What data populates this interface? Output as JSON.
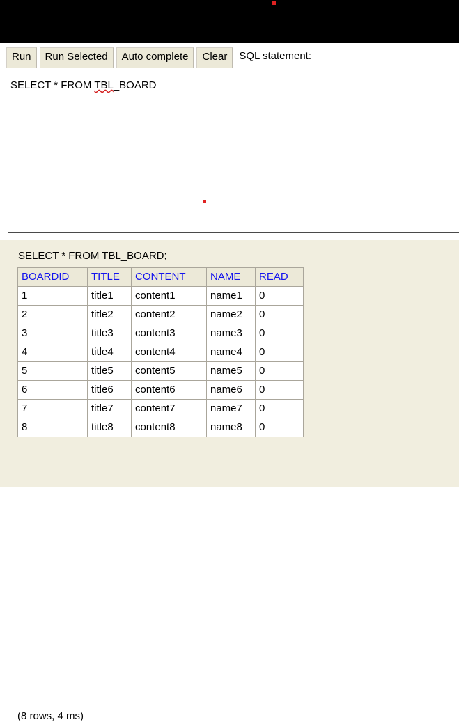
{
  "topbar": {
    "marker_color": "#e02222"
  },
  "toolbar": {
    "buttons": [
      {
        "label": "Run",
        "name": "run-button"
      },
      {
        "label": "Run Selected",
        "name": "run-selected-button"
      },
      {
        "label": "Auto complete",
        "name": "auto-complete-button"
      },
      {
        "label": "Clear",
        "name": "clear-button"
      }
    ],
    "sql_label": "SQL statement:"
  },
  "editor": {
    "value_prefix": "SELECT * FROM ",
    "value_misspelled": "TBL",
    "value_suffix": "_BOARD",
    "full_value": "SELECT * FROM TBL_BOARD",
    "placeholder": "SQL statement",
    "marker_color": "#e02222"
  },
  "result": {
    "query": "SELECT * FROM TBL_BOARD;",
    "header_color": "#1414ee",
    "columns": [
      "BOARDID",
      "TITLE",
      "CONTENT",
      "NAME",
      "READ"
    ],
    "rows": [
      [
        "1",
        "title1",
        "content1",
        "name1",
        "0"
      ],
      [
        "2",
        "title2",
        "content2",
        "name2",
        "0"
      ],
      [
        "3",
        "title3",
        "content3",
        "name3",
        "0"
      ],
      [
        "4",
        "title4",
        "content4",
        "name4",
        "0"
      ],
      [
        "5",
        "title5",
        "content5",
        "name5",
        "0"
      ],
      [
        "6",
        "title6",
        "content6",
        "name6",
        "0"
      ],
      [
        "7",
        "title7",
        "content7",
        "name7",
        "0"
      ],
      [
        "8",
        "title8",
        "content8",
        "name8",
        "0"
      ]
    ],
    "status": "(8 rows, 4 ms)"
  }
}
